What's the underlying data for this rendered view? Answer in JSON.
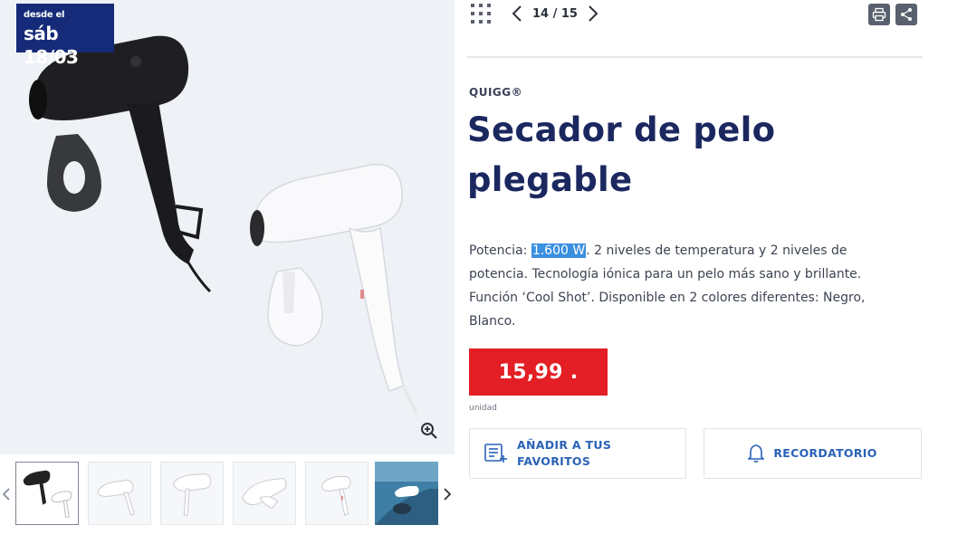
{
  "badge": {
    "line1": "desde el",
    "line2": "sáb 18/03"
  },
  "pager": {
    "current_total": "14 / 15"
  },
  "product": {
    "brand": "QUIGG®",
    "title": "Secador de pelo plegable",
    "description_pre": "Potencia: ",
    "description_highlight": "1.600 W",
    "description_post": ". 2 niveles de temperatura y 2 niveles de potencia. Tecnología iónica para un pelo más sano y brillante. Función ‘Cool Shot’. Disponible en 2 colores diferentes: Negro, Blanco.",
    "price": "15,99 .",
    "unit": "unidad"
  },
  "actions": {
    "favorites_label": "AÑADIR A TUS FAVORITOS",
    "reminder_label": "RECORDATORIO"
  },
  "icons": {
    "grid": "grid-icon",
    "prev": "chevron-left-icon",
    "next": "chevron-right-icon",
    "print": "print-icon",
    "share": "share-icon",
    "zoom": "zoom-in-icon",
    "favorites": "list-add-icon",
    "reminder": "bell-icon"
  },
  "colors": {
    "badge": "#152a78",
    "title": "#1b2860",
    "price_bg": "#e31e24",
    "action_text": "#2a62b8",
    "highlight": "#3b8fe0"
  }
}
